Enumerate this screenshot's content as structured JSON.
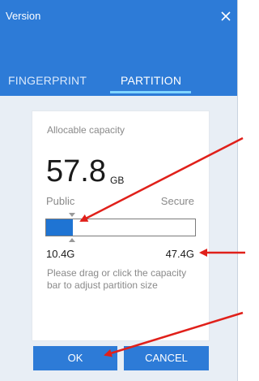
{
  "window": {
    "title": "Version"
  },
  "tabs": [
    {
      "label": "FINGERPRINT"
    },
    {
      "label": "PARTITION"
    }
  ],
  "partition": {
    "allocable_label": "Allocable capacity",
    "capacity_value": "57.8",
    "capacity_unit": "GB",
    "public_label": "Public",
    "secure_label": "Secure",
    "public_size": "10.4G",
    "secure_size": "47.4G",
    "public_fraction": 0.18,
    "hint": "Please drag or click the capacity bar to adjust partition size"
  },
  "buttons": {
    "ok": "OK",
    "cancel": "CANCEL"
  },
  "colors": {
    "accent": "#2d7bd7",
    "bar_fill": "#1f74d3",
    "tab_underline": "#7fd4ff",
    "annotation": "#e0201a"
  },
  "icons": {
    "close": "close-icon"
  }
}
